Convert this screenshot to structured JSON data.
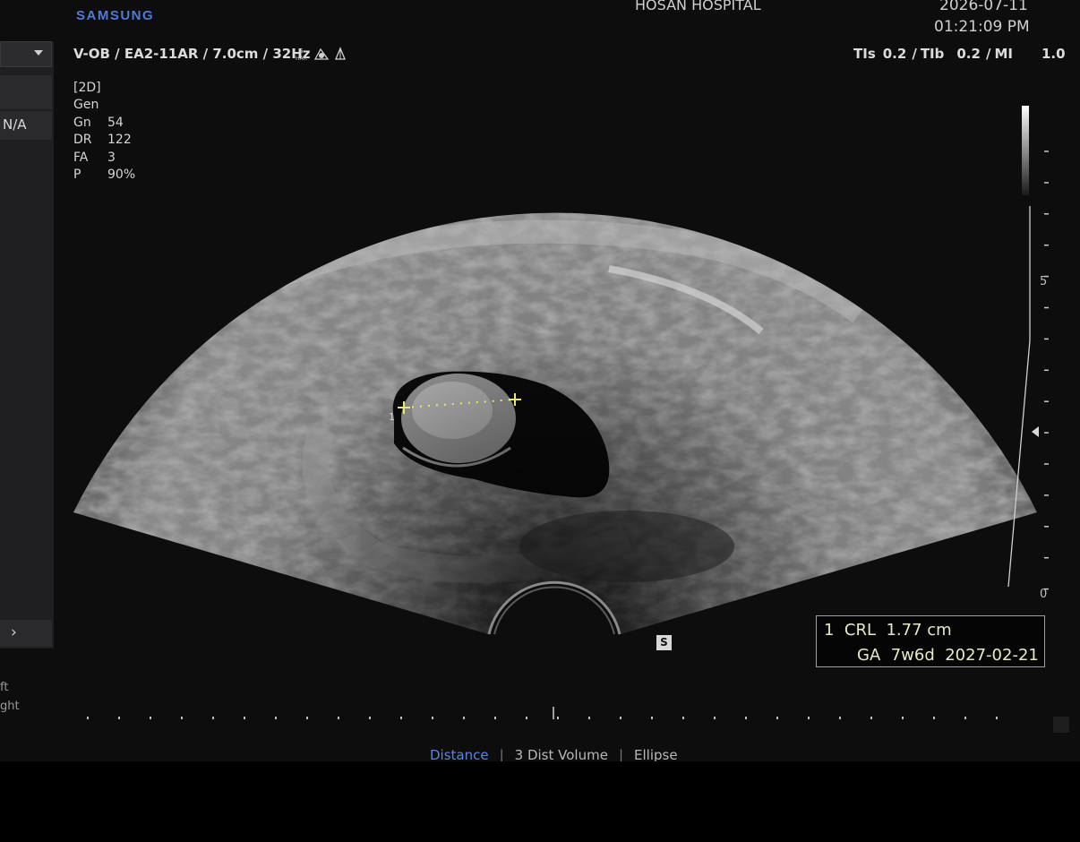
{
  "header": {
    "brand": "SAMSUNG",
    "hospital": "HOSAN HOSPITAL",
    "date": "2026-07-11",
    "time": "01:21:09 PM"
  },
  "probe": {
    "info": "V-OB / EA2-11AR / 7.0cm / 32Hz",
    "icons": [
      "s-har-icon",
      "fetal-icon",
      "cone-icon"
    ]
  },
  "safety": {
    "tis_label": "TIs",
    "tis_value": "0.2",
    "tib_label": "TIb",
    "tib_value": "0.2",
    "mi_label": "MI",
    "mi_value": "1.0"
  },
  "imaging_params": [
    {
      "k": "[2D]",
      "v": ""
    },
    {
      "k": "Gen",
      "v": ""
    },
    {
      "k": "Gn",
      "v": "54"
    },
    {
      "k": "DR",
      "v": "122"
    },
    {
      "k": "FA",
      "v": "3"
    },
    {
      "k": "P",
      "v": "90%"
    }
  ],
  "left_panel": {
    "field_value": "N/A",
    "side_labels": [
      "ft",
      "ght"
    ]
  },
  "depth_scale": {
    "labels": [
      "5",
      "0"
    ]
  },
  "measurement": {
    "index": "1",
    "name": "CRL",
    "value": "1.77 cm",
    "ga_label": "GA",
    "ga_value": "7w6d",
    "edd": "2027-02-21",
    "marker": "1"
  },
  "s_badge": "S",
  "tools": {
    "active": "Distance",
    "items": [
      "3 Dist Volume",
      "Ellipse"
    ]
  },
  "colors": {
    "brand": "#4f7bd6",
    "active_tool": "#5a86e0",
    "caliper": "#e8e86a"
  }
}
